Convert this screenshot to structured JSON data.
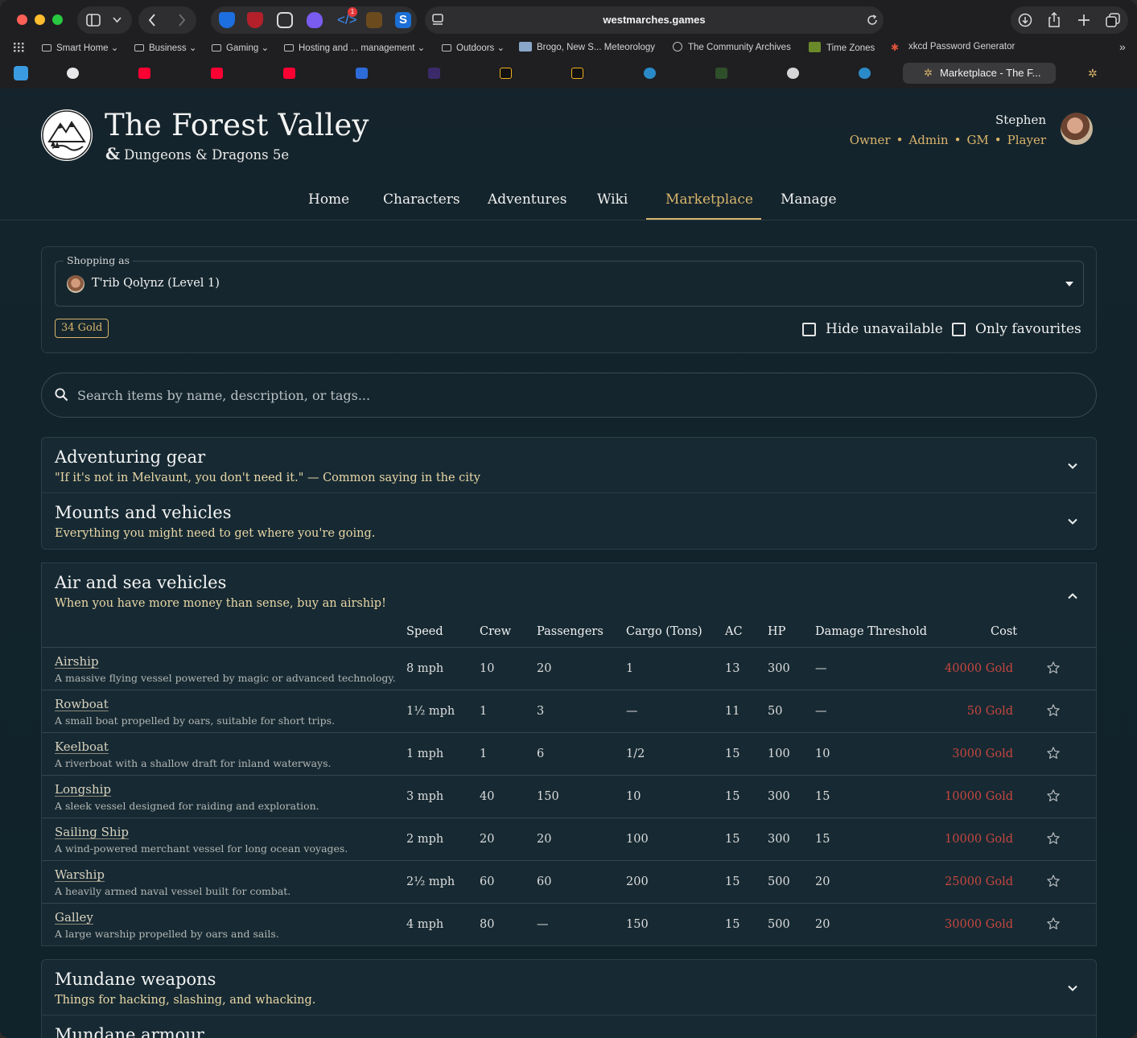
{
  "browser": {
    "url": "westmarches.games",
    "ext_badge": "1",
    "bookmarks": [
      "Smart Home",
      "Business",
      "Gaming",
      "Hosting and ... management",
      "Outdoors",
      "Brogo, New S... Meteorology",
      "The Community Archives",
      "Time Zones",
      "xkcd Password Generator"
    ],
    "active_tab": "Marketplace - The F..."
  },
  "site": {
    "title": "The Forest Valley",
    "system": "Dungeons & Dragons 5e",
    "system_glyph": "&"
  },
  "user": {
    "name": "Stephen",
    "roles": [
      "Owner",
      "Admin",
      "GM",
      "Player"
    ],
    "role_sep": "•"
  },
  "nav": {
    "items": [
      "Home",
      "Characters",
      "Adventures",
      "Wiki",
      "Marketplace",
      "Manage"
    ],
    "active": "Marketplace"
  },
  "shop": {
    "legend": "Shopping as",
    "character": "T'rib Qolynz (Level 1)",
    "gold": "34 Gold",
    "hide_unavailable": "Hide unavailable",
    "only_favourites": "Only favourites"
  },
  "search": {
    "placeholder": "Search items by name, description, or tags..."
  },
  "categories": {
    "adventuring": {
      "title": "Adventuring gear",
      "subtitle": "\"If it's not in Melvaunt, you don't need it.\" — Common saying in the city"
    },
    "mounts": {
      "title": "Mounts and vehicles",
      "subtitle": "Everything you might need to get where you're going."
    },
    "air_sea": {
      "title": "Air and sea vehicles",
      "subtitle": "When you have more money than sense, buy an airship!"
    },
    "weapons": {
      "title": "Mundane weapons",
      "subtitle": "Things for hacking, slashing, and whacking."
    },
    "armour": {
      "title": "Mundane armour"
    }
  },
  "table": {
    "headers": {
      "speed": "Speed",
      "crew": "Crew",
      "passengers": "Passengers",
      "cargo": "Cargo (Tons)",
      "ac": "AC",
      "hp": "HP",
      "dt": "Damage Threshold",
      "cost": "Cost"
    },
    "rows": [
      {
        "name": "Airship",
        "desc": "A massive flying vessel powered by magic or advanced technology.",
        "speed": "8 mph",
        "crew": "10",
        "passengers": "20",
        "cargo": "1",
        "ac": "13",
        "hp": "300",
        "dt": "—",
        "cost": "40000 Gold"
      },
      {
        "name": "Rowboat",
        "desc": "A small boat propelled by oars, suitable for short trips.",
        "speed": "1½ mph",
        "crew": "1",
        "passengers": "3",
        "cargo": "—",
        "ac": "11",
        "hp": "50",
        "dt": "—",
        "cost": "50 Gold"
      },
      {
        "name": "Keelboat",
        "desc": "A riverboat with a shallow draft for inland waterways.",
        "speed": "1 mph",
        "crew": "1",
        "passengers": "6",
        "cargo": "1/2",
        "ac": "15",
        "hp": "100",
        "dt": "10",
        "cost": "3000 Gold"
      },
      {
        "name": "Longship",
        "desc": "A sleek vessel designed for raiding and exploration.",
        "speed": "3 mph",
        "crew": "40",
        "passengers": "150",
        "cargo": "10",
        "ac": "15",
        "hp": "300",
        "dt": "15",
        "cost": "10000 Gold"
      },
      {
        "name": "Sailing Ship",
        "desc": "A wind-powered merchant vessel for long ocean voyages.",
        "speed": "2 mph",
        "crew": "20",
        "passengers": "20",
        "cargo": "100",
        "ac": "15",
        "hp": "300",
        "dt": "15",
        "cost": "10000 Gold"
      },
      {
        "name": "Warship",
        "desc": "A heavily armed naval vessel built for combat.",
        "speed": "2½ mph",
        "crew": "60",
        "passengers": "60",
        "cargo": "200",
        "ac": "15",
        "hp": "500",
        "dt": "20",
        "cost": "25000 Gold"
      },
      {
        "name": "Galley",
        "desc": "A large warship propelled by oars and sails.",
        "speed": "4 mph",
        "crew": "80",
        "passengers": "—",
        "cargo": "150",
        "ac": "15",
        "hp": "500",
        "dt": "20",
        "cost": "30000 Gold"
      }
    ]
  },
  "colors": {
    "accent": "#d9b56c",
    "cost_unaffordable": "#c6453f",
    "page_bg": "#14232b"
  }
}
